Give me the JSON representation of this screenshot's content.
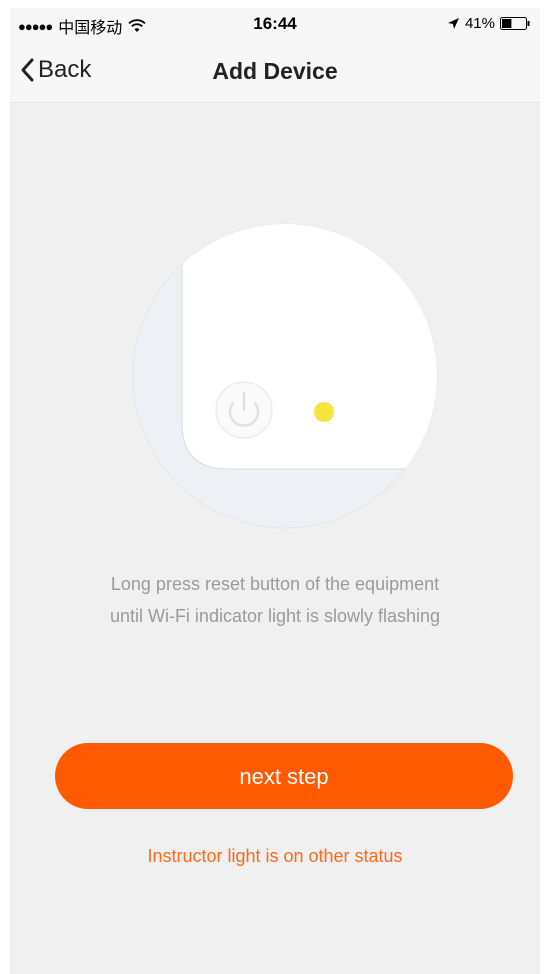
{
  "status_bar": {
    "signal": "●●●●●",
    "carrier": "中国移动",
    "time": "16:44",
    "battery_percent": "41%",
    "battery_level": 0.41
  },
  "nav": {
    "back_label": "Back",
    "title": "Add Device"
  },
  "illustration": {
    "indicator_color": "#f5e43c"
  },
  "instructions": {
    "line1": "Long press reset button of the equipment",
    "line2": "until Wi-Fi indicator light is slowly flashing"
  },
  "actions": {
    "next_label": "next step",
    "other_status_label": "Instructor light is on other status"
  },
  "colors": {
    "accent": "#ff5a00",
    "link": "#ff6a1a",
    "muted_text": "#9a9a9a"
  }
}
